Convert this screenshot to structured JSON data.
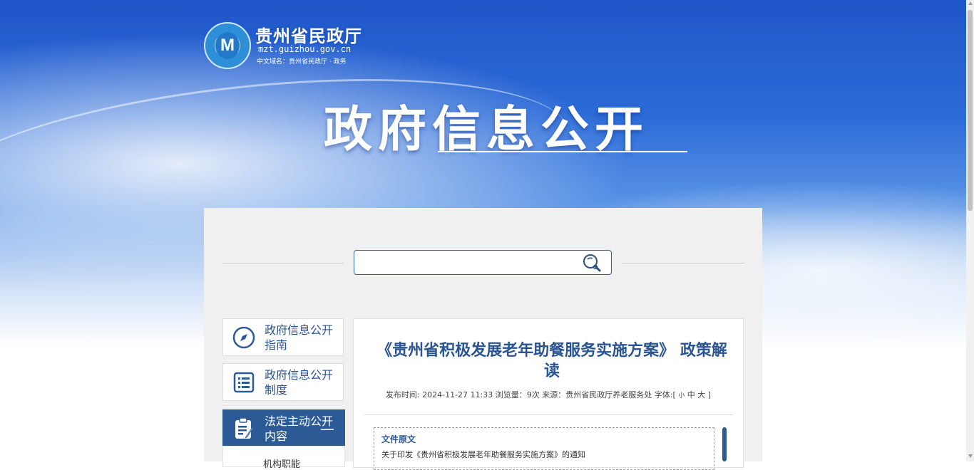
{
  "header": {
    "site_name": "贵州省民政厅",
    "site_url": "mzt.guizhou.gov.cn",
    "chinese_domain": "中文域名：贵州省民政厅 · 政务",
    "emblem_letter": "M",
    "page_title": "政府信息公开"
  },
  "search": {
    "placeholder": "",
    "value": "",
    "icon": "search-icon"
  },
  "sidebar": {
    "items": [
      {
        "label": "政府信息公开指南",
        "icon": "compass-icon"
      },
      {
        "label": "政府信息公开制度",
        "icon": "list-document-icon"
      },
      {
        "label": "法定主动公开内容",
        "icon": "edit-document-icon",
        "toggle": "—"
      }
    ],
    "sub_item_partial": "机构职能"
  },
  "article": {
    "title": "《贵州省积极发展老年助餐服务实施方案》 政策解读",
    "meta": {
      "publish_label": "发布时间: ",
      "publish_time": "2024-11-27 11:33",
      "views_label": " 浏览量：",
      "views": "9次",
      "source_label": " 来源：",
      "source": "贵州省民政厅养老服务处",
      "font_label": " 字体:[",
      "font_small": "小",
      "font_medium": "中",
      "font_large": "大",
      "font_close": " ]"
    },
    "attachment": {
      "heading": "文件原文",
      "link": "关于印发《贵州省积极发展老年助餐服务实施方案》的通知"
    }
  },
  "colors": {
    "primary_blue": "#2c5a95",
    "title_blue": "#2a5592",
    "hero_blue": "#1f56c9"
  }
}
